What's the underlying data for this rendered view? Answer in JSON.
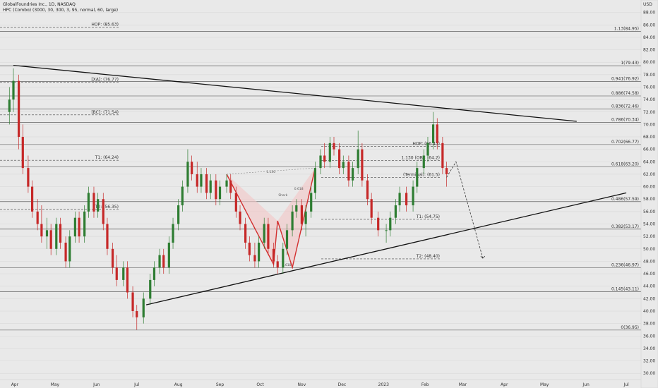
{
  "header": {
    "title": "GlobalFoundries Inc., 1D, NASDAQ",
    "indicator": "HPC (Combo) (3000, 30, 300, 3, 95, normal, 60, large)"
  },
  "colors": {
    "background": "#e9e9e9",
    "bull": "#2e7d32",
    "bear": "#c62828",
    "trendline": "#111111",
    "pattern_fill": "#f3c6c6",
    "pattern_line": "#d32f2f"
  },
  "chart_data": {
    "type": "candlestick",
    "symbol": "GFS",
    "exchange": "NASDAQ",
    "interval": "1D",
    "y_axis": {
      "unit": "USD",
      "ticks": [
        30,
        32,
        34,
        36,
        38,
        40,
        42,
        44,
        46,
        48,
        50,
        52,
        54,
        56,
        58,
        60,
        62,
        64,
        66,
        68,
        70,
        72,
        74,
        76,
        78,
        80,
        82,
        84,
        86,
        88
      ],
      "tick_labels": [
        "30.00",
        "32.00",
        "34.00",
        "36.00",
        "38.00",
        "40.00",
        "42.00",
        "44.00",
        "46.00",
        "48.00",
        "50.00",
        "52.00",
        "54.00",
        "56.00",
        "58.00",
        "60.00",
        "62.00",
        "64.00",
        "66.00",
        "68.00",
        "70.00",
        "72.00",
        "74.00",
        "76.00",
        "78.00",
        "80.00",
        "82.00",
        "84.00",
        "86.00",
        "88.00"
      ],
      "range": [
        29,
        90
      ]
    },
    "x_axis": {
      "labels": [
        "Apr",
        "May",
        "Jun",
        "Jul",
        "Aug",
        "Sep",
        "Oct",
        "Nov",
        "Dec",
        "2023",
        "Feb",
        "Mar",
        "Apr",
        "May",
        "Jun",
        "Jul"
      ]
    },
    "candles": [
      {
        "t": "2022-03-28",
        "o": 72,
        "h": 76,
        "l": 70,
        "c": 74
      },
      {
        "t": "2022-03-31",
        "o": 74,
        "h": 79,
        "l": 72,
        "c": 77
      },
      {
        "t": "2022-04-04",
        "o": 77,
        "h": 78,
        "l": 66,
        "c": 68
      },
      {
        "t": "2022-04-07",
        "o": 68,
        "h": 70,
        "l": 62,
        "c": 63
      },
      {
        "t": "2022-04-11",
        "o": 63,
        "h": 65,
        "l": 59,
        "c": 60
      },
      {
        "t": "2022-04-14",
        "o": 60,
        "h": 61,
        "l": 55,
        "c": 56
      },
      {
        "t": "2022-04-18",
        "o": 56,
        "h": 58,
        "l": 53,
        "c": 54
      },
      {
        "t": "2022-04-21",
        "o": 54,
        "h": 57,
        "l": 51,
        "c": 52
      },
      {
        "t": "2022-04-25",
        "o": 52,
        "h": 55,
        "l": 50,
        "c": 53
      },
      {
        "t": "2022-04-28",
        "o": 53,
        "h": 54,
        "l": 49,
        "c": 50
      },
      {
        "t": "2022-05-02",
        "o": 50,
        "h": 55,
        "l": 49,
        "c": 54
      },
      {
        "t": "2022-05-05",
        "o": 54,
        "h": 55,
        "l": 50,
        "c": 51
      },
      {
        "t": "2022-05-09",
        "o": 51,
        "h": 52,
        "l": 47,
        "c": 48
      },
      {
        "t": "2022-05-12",
        "o": 48,
        "h": 53,
        "l": 47,
        "c": 52
      },
      {
        "t": "2022-05-16",
        "o": 52,
        "h": 56,
        "l": 51,
        "c": 55
      },
      {
        "t": "2022-05-19",
        "o": 55,
        "h": 56,
        "l": 51,
        "c": 52
      },
      {
        "t": "2022-05-23",
        "o": 52,
        "h": 57,
        "l": 51,
        "c": 56
      },
      {
        "t": "2022-05-26",
        "o": 56,
        "h": 60,
        "l": 55,
        "c": 59
      },
      {
        "t": "2022-05-30",
        "o": 59,
        "h": 60,
        "l": 55,
        "c": 56
      },
      {
        "t": "2022-06-02",
        "o": 56,
        "h": 59,
        "l": 55,
        "c": 58
      },
      {
        "t": "2022-06-06",
        "o": 58,
        "h": 59,
        "l": 53,
        "c": 54
      },
      {
        "t": "2022-06-09",
        "o": 54,
        "h": 55,
        "l": 49,
        "c": 50
      },
      {
        "t": "2022-06-13",
        "o": 50,
        "h": 51,
        "l": 46,
        "c": 47
      },
      {
        "t": "2022-06-16",
        "o": 47,
        "h": 49,
        "l": 44,
        "c": 45
      },
      {
        "t": "2022-06-21",
        "o": 45,
        "h": 48,
        "l": 44,
        "c": 47
      },
      {
        "t": "2022-06-24",
        "o": 47,
        "h": 48,
        "l": 42,
        "c": 43
      },
      {
        "t": "2022-06-28",
        "o": 43,
        "h": 44,
        "l": 39,
        "c": 40
      },
      {
        "t": "2022-07-01",
        "o": 40,
        "h": 41,
        "l": 37,
        "c": 39
      },
      {
        "t": "2022-07-06",
        "o": 39,
        "h": 43,
        "l": 38,
        "c": 42
      },
      {
        "t": "2022-07-11",
        "o": 42,
        "h": 46,
        "l": 41,
        "c": 45
      },
      {
        "t": "2022-07-14",
        "o": 45,
        "h": 48,
        "l": 44,
        "c": 47
      },
      {
        "t": "2022-07-18",
        "o": 47,
        "h": 50,
        "l": 46,
        "c": 49
      },
      {
        "t": "2022-07-21",
        "o": 49,
        "h": 50,
        "l": 46,
        "c": 47
      },
      {
        "t": "2022-07-25",
        "o": 47,
        "h": 52,
        "l": 46,
        "c": 51
      },
      {
        "t": "2022-07-28",
        "o": 51,
        "h": 55,
        "l": 50,
        "c": 54
      },
      {
        "t": "2022-08-01",
        "o": 54,
        "h": 58,
        "l": 53,
        "c": 57
      },
      {
        "t": "2022-08-04",
        "o": 57,
        "h": 61,
        "l": 56,
        "c": 60
      },
      {
        "t": "2022-08-08",
        "o": 60,
        "h": 66,
        "l": 59,
        "c": 64
      },
      {
        "t": "2022-08-11",
        "o": 64,
        "h": 65,
        "l": 61,
        "c": 62
      },
      {
        "t": "2022-08-15",
        "o": 62,
        "h": 64,
        "l": 59,
        "c": 60
      },
      {
        "t": "2022-08-18",
        "o": 60,
        "h": 63,
        "l": 59,
        "c": 62
      },
      {
        "t": "2022-08-22",
        "o": 62,
        "h": 63,
        "l": 58,
        "c": 59
      },
      {
        "t": "2022-08-25",
        "o": 59,
        "h": 62,
        "l": 58,
        "c": 61
      },
      {
        "t": "2022-08-29",
        "o": 61,
        "h": 62,
        "l": 57,
        "c": 58
      },
      {
        "t": "2022-09-01",
        "o": 58,
        "h": 61,
        "l": 57,
        "c": 60
      },
      {
        "t": "2022-09-06",
        "o": 60,
        "h": 62,
        "l": 59,
        "c": 61
      },
      {
        "t": "2022-09-09",
        "o": 61,
        "h": 62,
        "l": 58,
        "c": 59
      },
      {
        "t": "2022-09-13",
        "o": 59,
        "h": 60,
        "l": 55,
        "c": 56
      },
      {
        "t": "2022-09-16",
        "o": 56,
        "h": 57,
        "l": 53,
        "c": 54
      },
      {
        "t": "2022-09-20",
        "o": 54,
        "h": 55,
        "l": 50,
        "c": 51
      },
      {
        "t": "2022-09-23",
        "o": 51,
        "h": 52,
        "l": 48,
        "c": 49
      },
      {
        "t": "2022-09-27",
        "o": 49,
        "h": 51,
        "l": 47,
        "c": 48
      },
      {
        "t": "2022-09-30",
        "o": 48,
        "h": 52,
        "l": 47,
        "c": 51
      },
      {
        "t": "2022-10-04",
        "o": 51,
        "h": 55,
        "l": 50,
        "c": 54
      },
      {
        "t": "2022-10-07",
        "o": 54,
        "h": 55,
        "l": 49,
        "c": 50
      },
      {
        "t": "2022-10-11",
        "o": 50,
        "h": 51,
        "l": 47,
        "c": 48
      },
      {
        "t": "2022-10-14",
        "o": 48,
        "h": 49,
        "l": 46,
        "c": 47
      },
      {
        "t": "2022-10-18",
        "o": 47,
        "h": 51,
        "l": 46,
        "c": 50
      },
      {
        "t": "2022-10-21",
        "o": 50,
        "h": 54,
        "l": 49,
        "c": 53
      },
      {
        "t": "2022-10-25",
        "o": 53,
        "h": 57,
        "l": 52,
        "c": 56
      },
      {
        "t": "2022-10-28",
        "o": 56,
        "h": 58,
        "l": 55,
        "c": 57
      },
      {
        "t": "2022-11-01",
        "o": 57,
        "h": 58,
        "l": 53,
        "c": 54
      },
      {
        "t": "2022-11-04",
        "o": 54,
        "h": 57,
        "l": 52,
        "c": 56
      },
      {
        "t": "2022-11-08",
        "o": 56,
        "h": 60,
        "l": 55,
        "c": 59
      },
      {
        "t": "2022-11-11",
        "o": 59,
        "h": 64,
        "l": 58,
        "c": 63
      },
      {
        "t": "2022-11-15",
        "o": 63,
        "h": 66,
        "l": 62,
        "c": 65
      },
      {
        "t": "2022-11-18",
        "o": 65,
        "h": 67,
        "l": 63,
        "c": 64
      },
      {
        "t": "2022-11-22",
        "o": 64,
        "h": 68,
        "l": 63,
        "c": 67
      },
      {
        "t": "2022-11-25",
        "o": 67,
        "h": 68,
        "l": 65,
        "c": 66
      },
      {
        "t": "2022-11-29",
        "o": 66,
        "h": 67,
        "l": 62,
        "c": 63
      },
      {
        "t": "2022-12-02",
        "o": 63,
        "h": 65,
        "l": 62,
        "c": 64
      },
      {
        "t": "2022-12-06",
        "o": 64,
        "h": 65,
        "l": 60,
        "c": 61
      },
      {
        "t": "2022-12-09",
        "o": 61,
        "h": 64,
        "l": 60,
        "c": 63
      },
      {
        "t": "2022-12-13",
        "o": 63,
        "h": 69,
        "l": 62,
        "c": 66
      },
      {
        "t": "2022-12-16",
        "o": 66,
        "h": 67,
        "l": 60,
        "c": 61
      },
      {
        "t": "2022-12-20",
        "o": 61,
        "h": 62,
        "l": 57,
        "c": 58
      },
      {
        "t": "2022-12-23",
        "o": 58,
        "h": 59,
        "l": 54,
        "c": 55
      },
      {
        "t": "2022-12-28",
        "o": 55,
        "h": 56,
        "l": 52,
        "c": 53
      },
      {
        "t": "2023-01-03",
        "o": 53,
        "h": 54,
        "l": 51,
        "c": 53
      },
      {
        "t": "2023-01-06",
        "o": 53,
        "h": 56,
        "l": 52,
        "c": 55
      },
      {
        "t": "2023-01-10",
        "o": 55,
        "h": 58,
        "l": 54,
        "c": 57
      },
      {
        "t": "2023-01-13",
        "o": 57,
        "h": 60,
        "l": 56,
        "c": 59
      },
      {
        "t": "2023-01-18",
        "o": 59,
        "h": 60,
        "l": 56,
        "c": 57
      },
      {
        "t": "2023-01-23",
        "o": 57,
        "h": 61,
        "l": 56,
        "c": 60
      },
      {
        "t": "2023-01-26",
        "o": 60,
        "h": 64,
        "l": 59,
        "c": 63
      },
      {
        "t": "2023-01-31",
        "o": 63,
        "h": 66,
        "l": 62,
        "c": 65
      },
      {
        "t": "2023-02-03",
        "o": 65,
        "h": 68,
        "l": 64,
        "c": 67
      },
      {
        "t": "2023-02-07",
        "o": 67,
        "h": 72,
        "l": 66,
        "c": 70
      },
      {
        "t": "2023-02-10",
        "o": 70,
        "h": 71,
        "l": 66,
        "c": 67
      },
      {
        "t": "2023-02-14",
        "o": 67,
        "h": 68,
        "l": 62,
        "c": 63
      },
      {
        "t": "2023-02-17",
        "o": 63,
        "h": 64,
        "l": 60,
        "c": 62
      }
    ],
    "trendlines": [
      {
        "name": "upper",
        "points": [
          [
            "2022-03-31",
            79.5
          ],
          [
            "2023-05-25",
            70.5
          ]
        ]
      },
      {
        "name": "lower",
        "points": [
          [
            "2022-07-08",
            41
          ],
          [
            "2023-07-01",
            59
          ]
        ]
      }
    ],
    "levels_right": [
      {
        "label": "1.13(84.95)",
        "value": 84.95
      },
      {
        "label": "1(79.43)",
        "value": 79.43
      },
      {
        "label": "0.941(76.92)",
        "value": 76.92
      },
      {
        "label": "0.886(74.58)",
        "value": 74.58
      },
      {
        "label": "0.836(72.46)",
        "value": 72.46
      },
      {
        "label": "0.786(70.34)",
        "value": 70.34
      },
      {
        "label": "0.702(66.77)",
        "value": 66.77
      },
      {
        "label": "0.618(63.20)",
        "value": 63.2
      },
      {
        "label": "0.486(57.59)",
        "value": 57.59
      },
      {
        "label": "0.382(53.17)",
        "value": 53.17
      },
      {
        "label": "0.236(46.97)",
        "value": 46.97
      },
      {
        "label": "0.145(43.11)",
        "value": 43.11
      },
      {
        "label": "0(36.95)",
        "value": 36.95
      }
    ],
    "levels_left": [
      {
        "label": "HOP: (85.63)",
        "value": 85.63
      },
      {
        "label": "[XA]: (76.77)",
        "value": 76.77
      },
      {
        "label": "[BC]: (71.54)",
        "value": 71.54
      },
      {
        "label": "T1: (64.24)",
        "value": 64.24
      },
      {
        "label": "T2: (56.35)",
        "value": 56.35
      }
    ],
    "levels_recent": [
      {
        "label": "HOP: (66.45)",
        "value": 66.45
      },
      {
        "label": "1.130 (OB): (64.2)",
        "value": 64.2
      },
      {
        "label": "(Terminal): (61.5)",
        "value": 61.5
      },
      {
        "label": "T1: (54.75)",
        "value": 54.75
      },
      {
        "label": "T2: (48.40)",
        "value": 48.4
      }
    ],
    "pattern": {
      "label": "Shark",
      "ratio_labels": [
        "1.130",
        "0.618",
        "1.618"
      ],
      "points": [
        [
          "2022-09-06",
          62
        ],
        [
          "2022-10-11",
          47.5
        ],
        [
          "2022-10-14",
          54.5
        ],
        [
          "2022-10-25",
          47
        ],
        [
          "2022-11-11",
          63
        ]
      ]
    },
    "projection": [
      [
        "2023-02-17",
        61.5
      ],
      [
        "2023-02-24",
        64
      ],
      [
        "2023-03-09",
        54
      ],
      [
        "2023-03-16",
        48.5
      ]
    ],
    "grid": true
  }
}
